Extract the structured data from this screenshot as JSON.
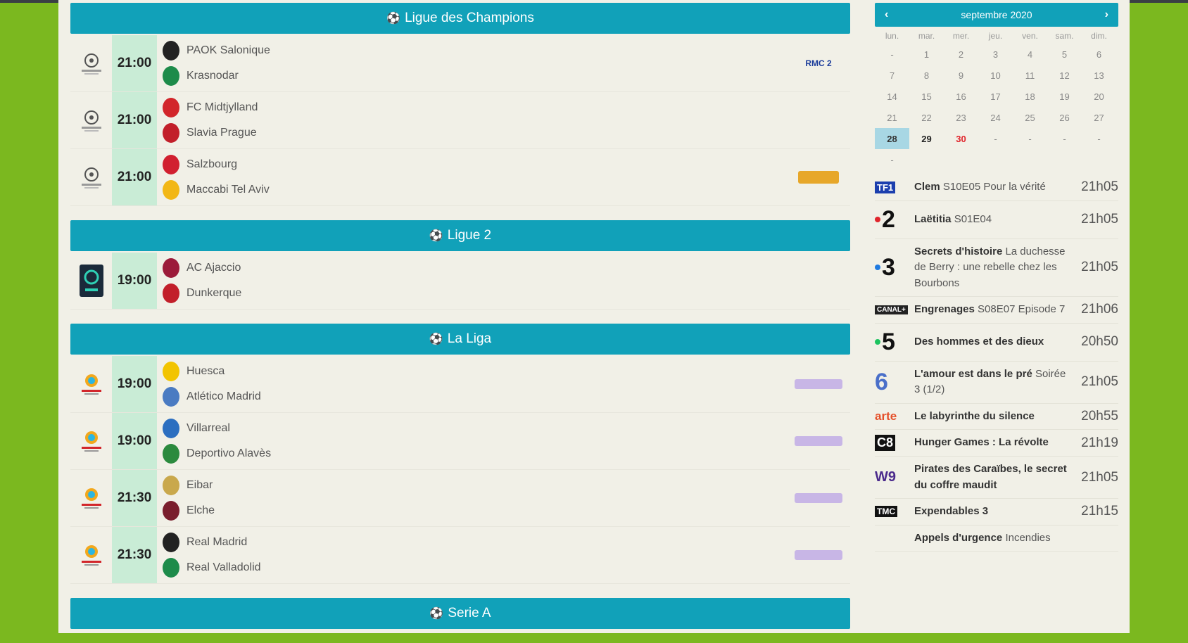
{
  "sections": [
    {
      "title": "Ligue des Champions",
      "comp": "ucl",
      "matches": [
        {
          "time": "21:00",
          "home": "PAOK Salonique",
          "away": "Krasnodar",
          "channel": "RMC 2",
          "channel_key": "rmc"
        },
        {
          "time": "21:00",
          "home": "FC Midtjylland",
          "away": "Slavia Prague",
          "channel": "",
          "channel_key": ""
        },
        {
          "time": "21:00",
          "home": "Salzbourg",
          "away": "Maccabi Tel Aviv",
          "channel": "",
          "channel_key": "tf"
        }
      ]
    },
    {
      "title": "Ligue 2",
      "comp": "l2",
      "matches": [
        {
          "time": "19:00",
          "home": "AC Ajaccio",
          "away": "Dunkerque",
          "channel": "",
          "channel_key": ""
        }
      ]
    },
    {
      "title": "La Liga",
      "comp": "liga",
      "matches": [
        {
          "time": "19:00",
          "home": "Huesca",
          "away": "Atlético Madrid",
          "channel": "",
          "channel_key": "bein"
        },
        {
          "time": "19:00",
          "home": "Villarreal",
          "away": "Deportivo Alavès",
          "channel": "",
          "channel_key": "bein"
        },
        {
          "time": "21:30",
          "home": "Eibar",
          "away": "Elche",
          "channel": "",
          "channel_key": "bein"
        },
        {
          "time": "21:30",
          "home": "Real Madrid",
          "away": "Real Valladolid",
          "channel": "",
          "channel_key": "bein"
        }
      ]
    },
    {
      "title": "Serie A",
      "comp": "seriea",
      "matches": []
    }
  ],
  "calendar": {
    "month": "septembre 2020",
    "prev": "‹",
    "next": "›",
    "days_of_week": [
      "lun.",
      "mar.",
      "mer.",
      "jeu.",
      "ven.",
      "sam.",
      "dim."
    ],
    "cells": [
      "-",
      "1",
      "2",
      "3",
      "4",
      "5",
      "6",
      "7",
      "8",
      "9",
      "10",
      "11",
      "12",
      "13",
      "14",
      "15",
      "16",
      "17",
      "18",
      "19",
      "20",
      "21",
      "22",
      "23",
      "24",
      "25",
      "26",
      "27",
      "28",
      "29",
      "30",
      "-",
      "-",
      "-",
      "-",
      "-"
    ],
    "today": "28"
  },
  "tv": [
    {
      "channel": "TF1",
      "show": "Clem",
      "detail": "S10E05 Pour la vérité",
      "time": "21h05"
    },
    {
      "channel": "2",
      "show": "Laëtitia",
      "detail": "S01E04",
      "time": "21h05"
    },
    {
      "channel": "3",
      "show": "Secrets d'histoire",
      "detail": "La duchesse de Berry : une rebelle chez les Bourbons",
      "time": "21h05"
    },
    {
      "channel": "CANAL+",
      "show": "Engrenages",
      "detail": "S08E07 Episode 7",
      "time": "21h06"
    },
    {
      "channel": "5",
      "show": "Des hommes et des dieux",
      "detail": "",
      "time": "20h50"
    },
    {
      "channel": "6",
      "show": "L'amour est dans le pré",
      "detail": "Soirée 3 (1/2)",
      "time": "21h05"
    },
    {
      "channel": "arte",
      "show": "Le labyrinthe du silence",
      "detail": "",
      "time": "20h55"
    },
    {
      "channel": "C8",
      "show": "Hunger Games : La révolte",
      "detail": "",
      "time": "21h19"
    },
    {
      "channel": "W9",
      "show": "Pirates des Caraïbes, le secret du coffre maudit",
      "detail": "",
      "time": "21h05"
    },
    {
      "channel": "TMC",
      "show": "Expendables 3",
      "detail": "",
      "time": "21h15"
    },
    {
      "channel": "",
      "show": "Appels d'urgence",
      "detail": "Incendies",
      "time": ""
    }
  ],
  "colors": {
    "accent": "#11a1b9",
    "time_bg": "#c9ecd6",
    "background": "#7bb81f",
    "page": "#f1f0e7",
    "today": "#a8d7e4",
    "sunday_red": "#e0242b"
  }
}
